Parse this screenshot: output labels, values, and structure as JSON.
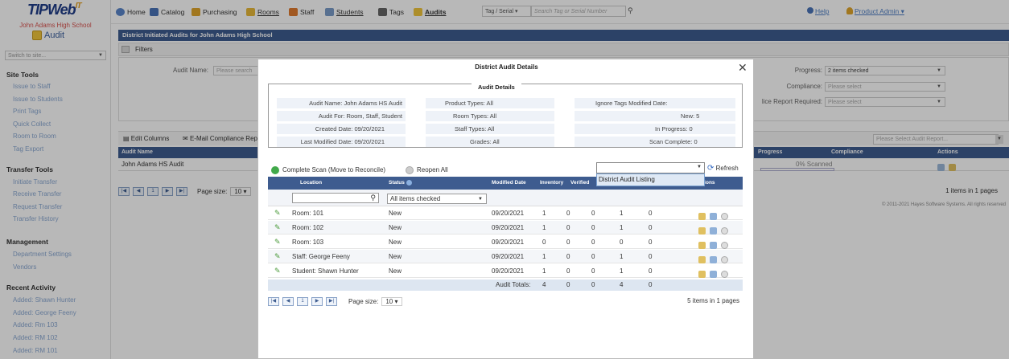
{
  "app": {
    "logo_main": "TIPWeb",
    "logo_suffix": "IT",
    "school": "John Adams High School",
    "module": "Audit",
    "site_placeholder": "Switch to site..."
  },
  "sidebar": {
    "site_tools": {
      "heading": "Site Tools",
      "items": [
        "Issue to Staff",
        "Issue to Students",
        "Print Tags",
        "Quick Collect",
        "Room to Room",
        "Tag Export"
      ]
    },
    "transfer_tools": {
      "heading": "Transfer Tools",
      "items": [
        "Initiate Transfer",
        "Receive Transfer",
        "Request Transfer",
        "Transfer History"
      ]
    },
    "management": {
      "heading": "Management",
      "items": [
        "Department Settings",
        "Vendors"
      ]
    },
    "recent": {
      "heading": "Recent Activity",
      "items": [
        "Added: Shawn Hunter",
        "Added: George Feeny",
        "Added: Rm 103",
        "Added: RM 102",
        "Added: RM 101"
      ]
    }
  },
  "topnav": {
    "items": [
      "Home",
      "Catalog",
      "Purchasing",
      "Rooms",
      "Staff",
      "Students",
      "Tags",
      "Audits"
    ],
    "tag_select": "Tag / Serial",
    "search_placeholder": "Search Tag or Serial Number",
    "help": "Help",
    "user": "Product Admin"
  },
  "page": {
    "title": "District Initiated Audits for John Adams High School",
    "filters_label": "Filters",
    "audit_name_label": "Audit Name:",
    "audit_name_placeholder": "Please search",
    "progress_label": "Progress:",
    "progress_value": "2 items checked",
    "compliance_label": "Compliance:",
    "compliance_placeholder": "Please select",
    "compliance_report_label": "lice Report Required:",
    "compliance_report_placeholder": "Please select",
    "edit_columns": "Edit Columns",
    "email_compliance": "E-Mail Compliance Rep",
    "audit_report_placeholder": "Please Select Audit Report...",
    "grid_headers": {
      "name": "Audit Name",
      "progress": "Progress",
      "compliance": "Compliance",
      "actions": "Actions"
    },
    "grid_row": {
      "name": "John Adams HS Audit",
      "progress": "0% Scanned"
    },
    "page_size_label": "Page size:",
    "page_size": "10",
    "page_num": "1",
    "grid_info": "1 items in 1 pages",
    "footer": "© 2011-2021 Hayes Software Systems. All rights reserved"
  },
  "modal": {
    "title": "District Audit Details",
    "legend": "Audit Details",
    "details": {
      "audit_name": "Audit Name: John Adams HS Audit",
      "audit_for": "Audit For: Room, Staff, Student",
      "created": "Created Date: 09/20/2021",
      "modified": "Last Modified Date: 09/20/2021",
      "product_types": "Product Types: All",
      "room_types": "Room Types: All",
      "staff_types": "Staff Types: All",
      "grades": "Grades: All",
      "ignore_tags": "Ignore Tags Modified Date:",
      "new": "New: 5",
      "in_progress": "In Progress: 0",
      "scan_complete": "Scan Complete: 0"
    },
    "complete_scan": "Complete Scan (Move to Reconcile)",
    "reopen_all": "Reopen All",
    "listing_option": "District Audit Listing",
    "refresh": "Refresh",
    "headers": {
      "location": "Location",
      "status": "Status",
      "modified": "Modified Date",
      "inventory": "Inventory",
      "verified": "Verified",
      "actions": "tions"
    },
    "status_filter": "All items checked",
    "rows": [
      {
        "location": "Room: 101",
        "status": "New",
        "date": "09/20/2021",
        "c1": "1",
        "c2": "0",
        "c3": "0",
        "c4": "1",
        "c5": "0"
      },
      {
        "location": "Room: 102",
        "status": "New",
        "date": "09/20/2021",
        "c1": "1",
        "c2": "0",
        "c3": "0",
        "c4": "1",
        "c5": "0"
      },
      {
        "location": "Room: 103",
        "status": "New",
        "date": "09/20/2021",
        "c1": "0",
        "c2": "0",
        "c3": "0",
        "c4": "0",
        "c5": "0"
      },
      {
        "location": "Staff: George Feeny",
        "status": "New",
        "date": "09/20/2021",
        "c1": "1",
        "c2": "0",
        "c3": "0",
        "c4": "1",
        "c5": "0"
      },
      {
        "location": "Student: Shawn Hunter",
        "status": "New",
        "date": "09/20/2021",
        "c1": "1",
        "c2": "0",
        "c3": "0",
        "c4": "1",
        "c5": "0"
      }
    ],
    "totals": {
      "label": "Audit Totals:",
      "c1": "4",
      "c2": "0",
      "c3": "0",
      "c4": "4",
      "c5": "0"
    },
    "page_size_label": "Page size:",
    "page_size": "10",
    "page_num": "1",
    "pager_info": "5 items in 1 pages"
  },
  "colors": {
    "header_blue": "#3e5c8f",
    "link": "#4f7fc4",
    "scan_green": "#41a94a"
  }
}
